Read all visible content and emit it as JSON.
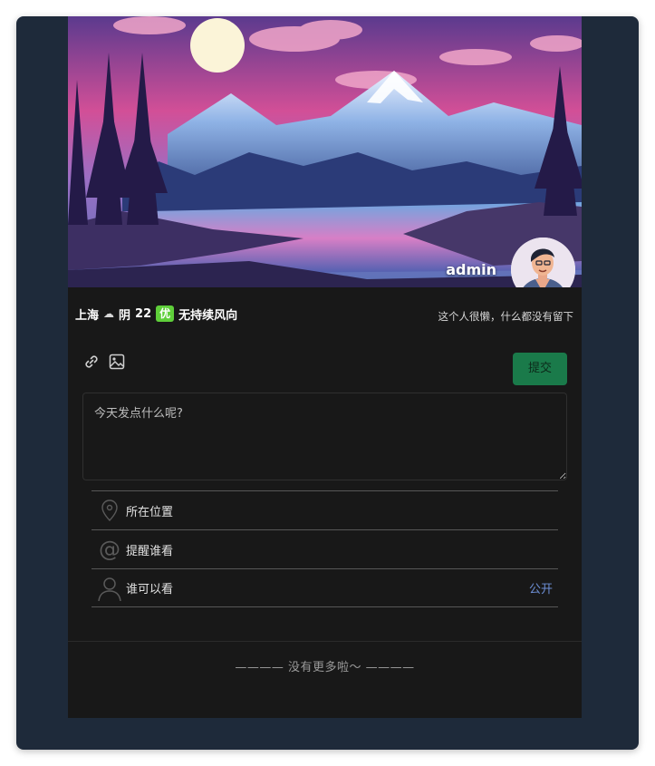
{
  "profile": {
    "username": "admin",
    "signature": "这个人很懒，什么都没有留下"
  },
  "weather": {
    "city": "上海",
    "condition_icon": "cloud-icon",
    "condition": "阴",
    "temperature": "22",
    "air_quality": "优",
    "wind": "无持续风向"
  },
  "composer": {
    "placeholder": "今天发点什么呢?",
    "value": "",
    "submit_label": "提交",
    "tools": [
      "link-icon",
      "image-icon"
    ]
  },
  "options": {
    "location_label": "所在位置",
    "mention_label": "提醒谁看",
    "visibility_label": "谁可以看",
    "visibility_value": "公开"
  },
  "feed": {
    "end_text": "———— 没有更多啦～ ————"
  },
  "colors": {
    "window_bg": "#1e2a3a",
    "panel_bg": "#181818",
    "submit_bg": "#1a7a4a",
    "aqi_badge": "#5fcf3a",
    "link_blue": "#6d8fd6"
  }
}
